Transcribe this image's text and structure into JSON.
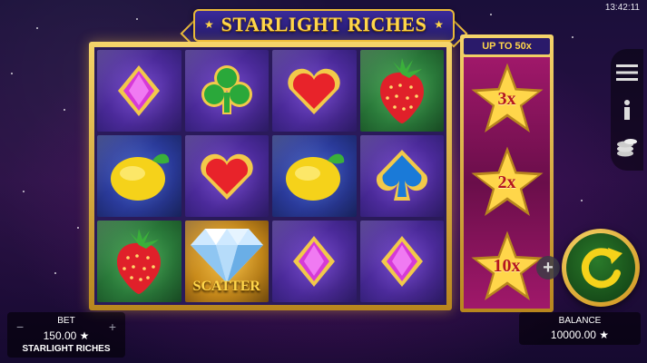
{
  "status_bar": {
    "time": "13:42:11"
  },
  "game": {
    "title": "STARLIGHT RICHES",
    "scatter_label": "SCATTER"
  },
  "reels": [
    [
      "diamond",
      "club",
      "heart",
      "strawberry"
    ],
    [
      "lemon",
      "heart",
      "lemon",
      "spade"
    ],
    [
      "strawberry",
      "scatter-diamond",
      "diamond",
      "diamond"
    ]
  ],
  "multiplier": {
    "header": "UP TO 50x",
    "values": [
      "3x",
      "2x",
      "10x"
    ]
  },
  "side_menu": {
    "icons": [
      "menu-icon",
      "info-icon",
      "coins-icon"
    ]
  },
  "bet": {
    "label": "BET",
    "value": "150.00 ★",
    "game_name": "STARLIGHT RICHES",
    "minus": "−",
    "plus": "+"
  },
  "balance": {
    "label": "BALANCE",
    "value": "10000.00 ★"
  },
  "controls": {
    "plus_symbol": "+"
  },
  "colors": {
    "gold": "#ffd64a",
    "spin_green": "#1f6a1f",
    "frame_gold": "#e8b93a"
  }
}
